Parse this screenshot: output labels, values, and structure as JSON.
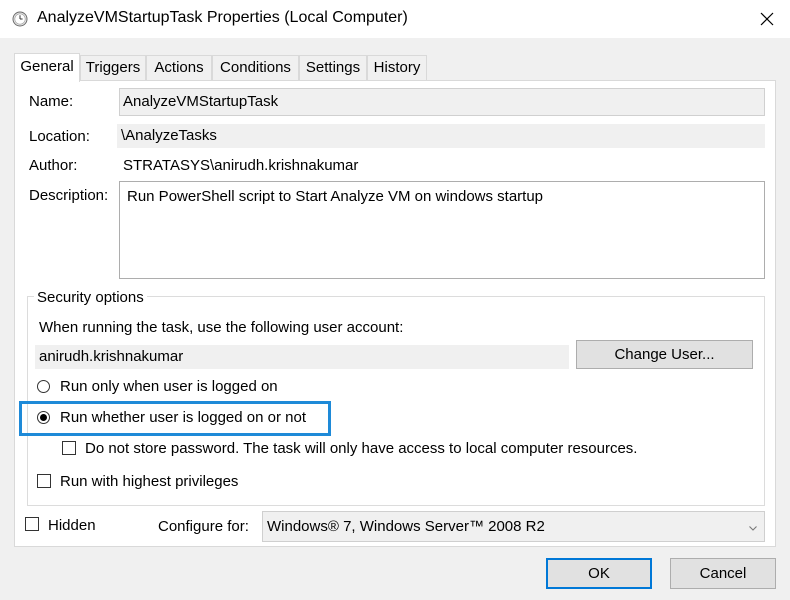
{
  "window": {
    "title": "AnalyzeVMStartupTask Properties (Local Computer)",
    "close_glyph": "✕"
  },
  "tabs": [
    {
      "label": "General",
      "active": true
    },
    {
      "label": "Triggers",
      "active": false
    },
    {
      "label": "Actions",
      "active": false
    },
    {
      "label": "Conditions",
      "active": false
    },
    {
      "label": "Settings",
      "active": false
    },
    {
      "label": "History",
      "active": false
    }
  ],
  "general": {
    "name_label": "Name:",
    "name_value": "AnalyzeVMStartupTask",
    "location_label": "Location:",
    "location_value": "\\AnalyzeTasks",
    "author_label": "Author:",
    "author_value": "STRATASYS\\anirudh.krishnakumar",
    "description_label": "Description:",
    "description_value": "Run PowerShell script to Start Analyze VM on windows startup"
  },
  "security": {
    "group_title": "Security options",
    "account_prompt": "When running the task, use the following user account:",
    "account_value": "anirudh.krishnakumar",
    "change_user_label": "Change User...",
    "radio_logged_on_label": "Run only when user is logged on",
    "radio_logged_on_selected": false,
    "radio_whether_label": "Run whether user is logged on or not",
    "radio_whether_selected": true,
    "no_store_password_label": "Do not store password.  The task will only have access to local computer resources.",
    "no_store_password_checked": false,
    "highest_privileges_label": "Run with highest privileges",
    "highest_privileges_checked": false
  },
  "footer": {
    "hidden_label": "Hidden",
    "hidden_checked": false,
    "configure_label": "Configure for:",
    "configure_value": "Windows® 7, Windows Server™ 2008 R2",
    "ok_label": "OK",
    "cancel_label": "Cancel"
  },
  "colors": {
    "accent": "#0078d7",
    "highlight_box": "#1e8ad8"
  }
}
